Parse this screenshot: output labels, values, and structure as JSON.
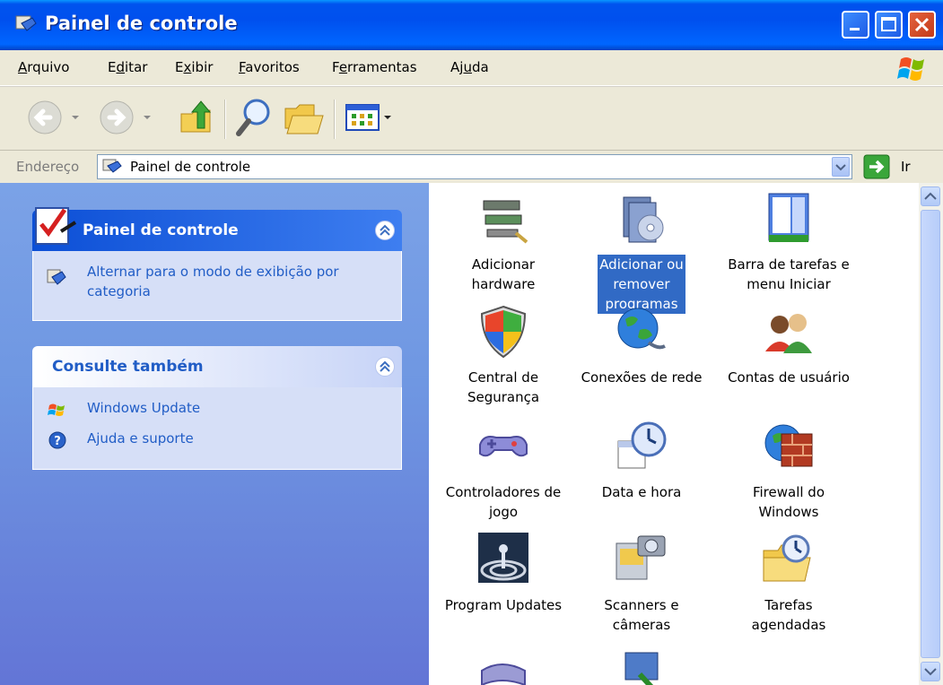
{
  "window": {
    "title": "Painel de controle"
  },
  "menu": [
    {
      "pre": "",
      "u": "A",
      "post": "rquivo"
    },
    {
      "pre": "E",
      "u": "d",
      "post": "itar"
    },
    {
      "pre": "E",
      "u": "x",
      "post": "ibir"
    },
    {
      "pre": "",
      "u": "F",
      "post": "avoritos"
    },
    {
      "pre": "F",
      "u": "e",
      "post": "rramentas"
    },
    {
      "pre": "Aj",
      "u": "u",
      "post": "da"
    }
  ],
  "toolbar": {
    "back_icon": "back-arrow-icon",
    "forward_icon": "forward-arrow-icon",
    "up_icon": "up-folder-icon",
    "search_icon": "search-icon",
    "folders_icon": "folders-icon",
    "views_icon": "views-icon"
  },
  "address": {
    "label": "Endereço",
    "value": "Painel de controle",
    "go": "Ir"
  },
  "tasks": {
    "panel1": {
      "title": "Painel de controle",
      "link1": "Alternar para o modo de exibição por",
      "link2": "categoria"
    },
    "panel2": {
      "title": "Consulte também",
      "links": [
        "Windows Update",
        "Ajuda e suporte"
      ]
    }
  },
  "items": [
    {
      "l1": "Adicionar",
      "l2": "hardware",
      "l3": ""
    },
    {
      "l1": "Adicionar ou",
      "l2": "remover",
      "l3": "programas"
    },
    {
      "l1": "Barra de tarefas e",
      "l2": "menu Iniciar",
      "l3": ""
    },
    {
      "l1": "Central de",
      "l2": "Segurança",
      "l3": ""
    },
    {
      "l1": "Conexões de rede",
      "l2": "",
      "l3": ""
    },
    {
      "l1": "Contas de usuário",
      "l2": "",
      "l3": ""
    },
    {
      "l1": "Controladores de",
      "l2": "jogo",
      "l3": ""
    },
    {
      "l1": "Data e hora",
      "l2": "",
      "l3": ""
    },
    {
      "l1": "Firewall do",
      "l2": "Windows",
      "l3": ""
    },
    {
      "l1": "Program Updates",
      "l2": "",
      "l3": ""
    },
    {
      "l1": "Scanners e",
      "l2": "câmeras",
      "l3": ""
    },
    {
      "l1": "Tarefas",
      "l2": "agendadas",
      "l3": ""
    }
  ],
  "colors": {
    "titlebar": "#0050ee",
    "link": "#215dc6",
    "selection": "#316ac5"
  }
}
